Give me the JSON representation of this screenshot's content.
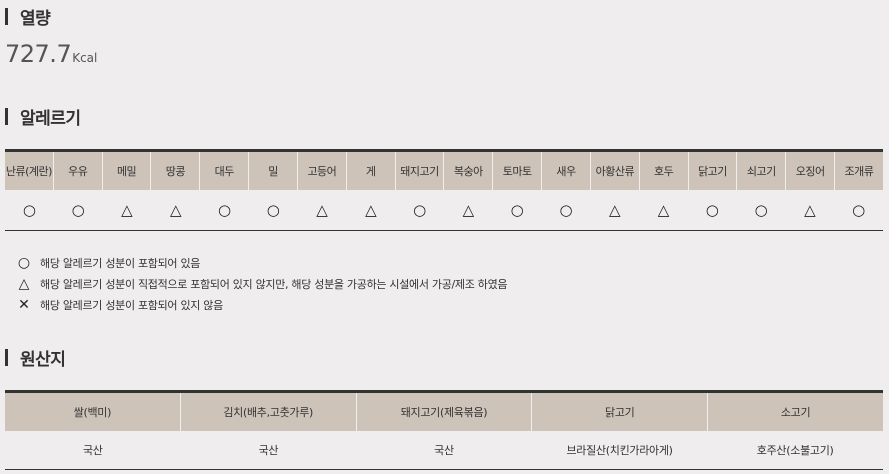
{
  "calorie": {
    "title": "열량",
    "value": "727.7",
    "unit": "Kcal"
  },
  "allergy": {
    "title": "알레르기",
    "headers": [
      "난류(계란)",
      "우유",
      "메밀",
      "땅콩",
      "대두",
      "밀",
      "고등어",
      "게",
      "돼지고기",
      "복숭아",
      "토마토",
      "새우",
      "아황산류",
      "호두",
      "닭고기",
      "쇠고기",
      "오징어",
      "조개류"
    ],
    "values": [
      "○",
      "○",
      "△",
      "△",
      "○",
      "○",
      "△",
      "△",
      "○",
      "△",
      "○",
      "○",
      "△",
      "△",
      "○",
      "○",
      "△",
      "○"
    ],
    "legend": [
      {
        "symbol": "○",
        "text": "해당 알레르기 성분이 포함되어 있음"
      },
      {
        "symbol": "△",
        "text": "해당 알레르기 성분이 직접적으로 포함되어 있지 않지만, 해당 성분을 가공하는 시설에서 가공/제조 하였음"
      },
      {
        "symbol": "✕",
        "text": "해당 알레르기 성분이 포함되어 있지 않음"
      }
    ]
  },
  "origin": {
    "title": "원산지",
    "headers": [
      "쌀(백미)",
      "김치(배추,고춧가루)",
      "돼지고기(제육볶음)",
      "닭고기",
      "소고기"
    ],
    "values": [
      "국산",
      "국산",
      "국산",
      "브라질산(치킨가라아게)",
      "호주산(소불고기)"
    ]
  }
}
